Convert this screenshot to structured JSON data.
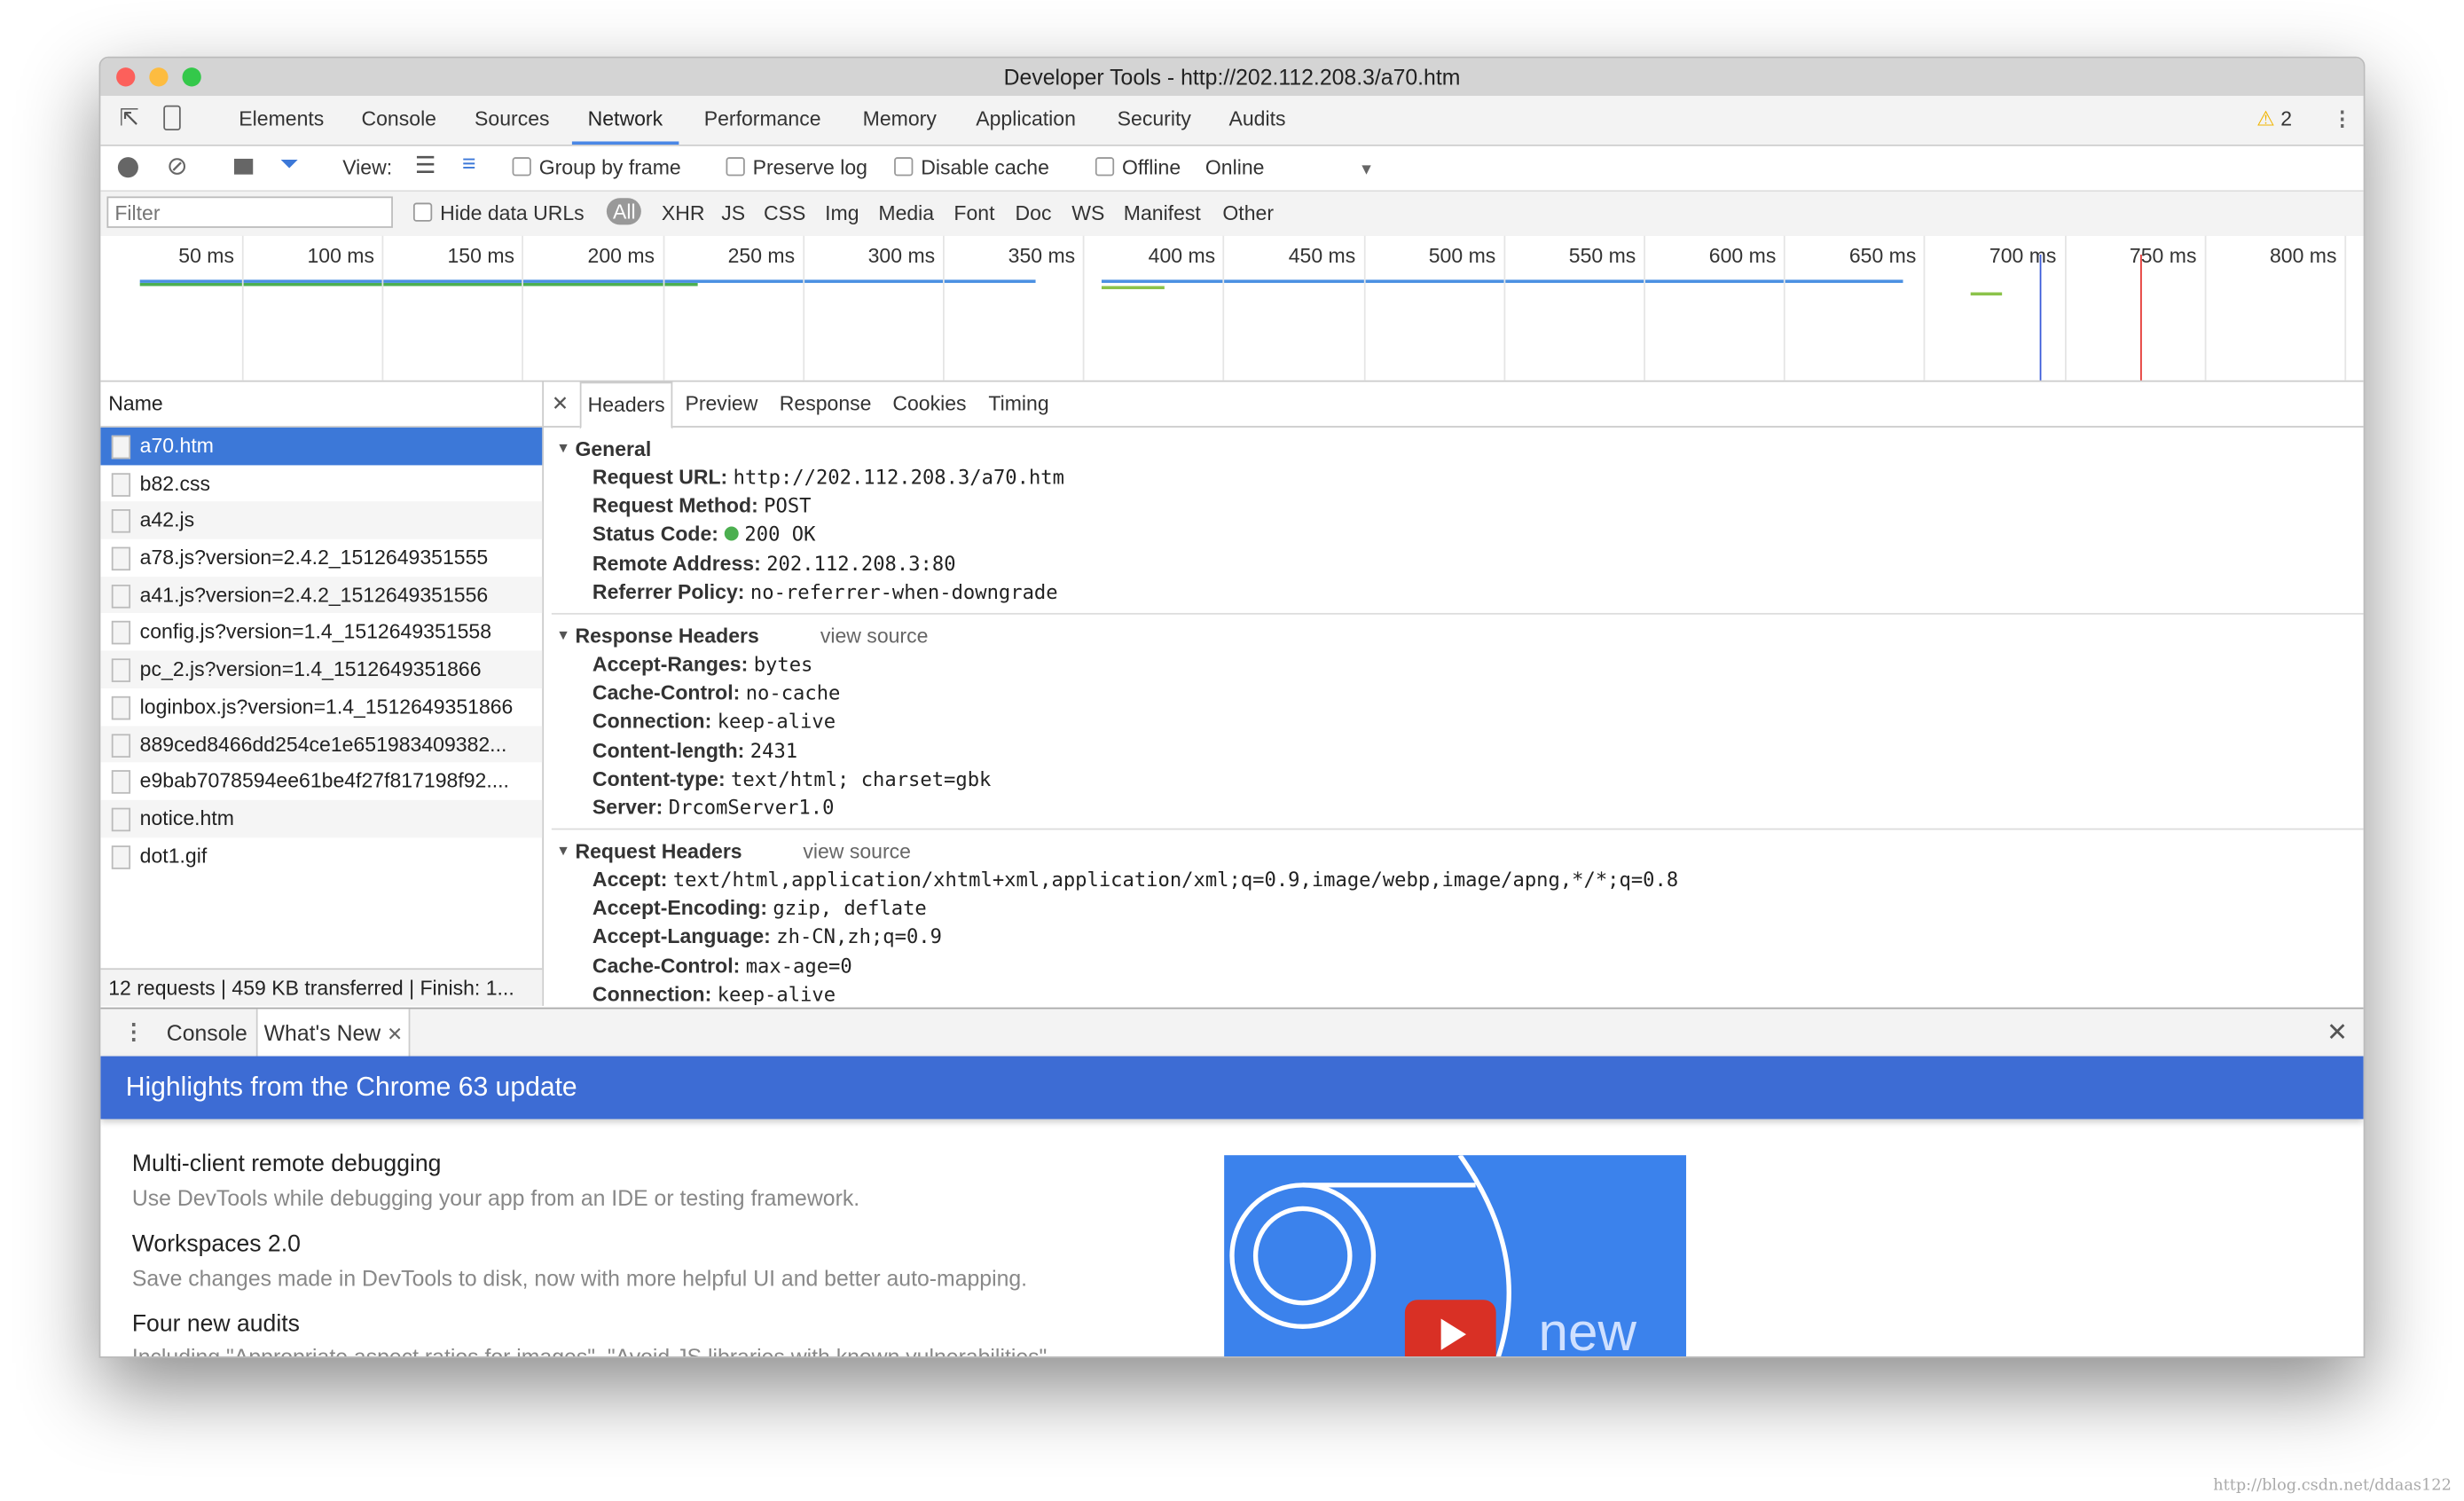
{
  "window": {
    "title": "Developer Tools - http://202.112.208.3/a70.htm"
  },
  "tabs": [
    "Elements",
    "Console",
    "Sources",
    "Network",
    "Performance",
    "Memory",
    "Application",
    "Security",
    "Audits"
  ],
  "active_tab": "Network",
  "warnings": {
    "count": "2"
  },
  "toolbar": {
    "view_label": "View:",
    "group_by_frame": "Group by frame",
    "preserve_log": "Preserve log",
    "disable_cache": "Disable cache",
    "offline": "Offline",
    "throttle": "Online"
  },
  "filterbar": {
    "placeholder": "Filter",
    "hide_data_urls": "Hide data URLs",
    "types": [
      "All",
      "XHR",
      "JS",
      "CSS",
      "Img",
      "Media",
      "Font",
      "Doc",
      "WS",
      "Manifest",
      "Other"
    ]
  },
  "timeline": {
    "ticks": [
      "50 ms",
      "100 ms",
      "150 ms",
      "200 ms",
      "250 ms",
      "300 ms",
      "350 ms",
      "400 ms",
      "450 ms",
      "500 ms",
      "550 ms",
      "600 ms",
      "650 ms",
      "700 ms",
      "750 ms",
      "800 ms"
    ]
  },
  "requests": {
    "header": "Name",
    "items": [
      "a70.htm",
      "b82.css",
      "a42.js",
      "a78.js?version=2.4.2_1512649351555",
      "a41.js?version=2.4.2_1512649351556",
      "config.js?version=1.4_1512649351558",
      "pc_2.js?version=1.4_1512649351866",
      "loginbox.js?version=1.4_1512649351866",
      "889ced8466dd254ce1e651983409382...",
      "e9bab7078594ee61be4f27f817198f92....",
      "notice.htm",
      "dot1.gif"
    ],
    "selected": "a70.htm",
    "status": "12 requests | 459 KB transferred | Finish: 1..."
  },
  "detail": {
    "tabs": [
      "Headers",
      "Preview",
      "Response",
      "Cookies",
      "Timing"
    ],
    "active": "Headers",
    "general": {
      "title": "General",
      "rows": [
        [
          "Request URL:",
          "http://202.112.208.3/a70.htm"
        ],
        [
          "Request Method:",
          "POST"
        ],
        [
          "Status Code:",
          "200 OK"
        ],
        [
          "Remote Address:",
          "202.112.208.3:80"
        ],
        [
          "Referrer Policy:",
          "no-referrer-when-downgrade"
        ]
      ]
    },
    "response": {
      "title": "Response Headers",
      "view_source": "view source",
      "rows": [
        [
          "Accept-Ranges:",
          "bytes"
        ],
        [
          "Cache-Control:",
          "no-cache"
        ],
        [
          "Connection:",
          "keep-alive"
        ],
        [
          "Content-length:",
          "2431"
        ],
        [
          "Content-type:",
          "text/html; charset=gbk"
        ],
        [
          "Server:",
          "DrcomServer1.0"
        ]
      ]
    },
    "request": {
      "title": "Request Headers",
      "view_source": "view source",
      "rows": [
        [
          "Accept:",
          "text/html,application/xhtml+xml,application/xml;q=0.9,image/webp,image/apng,*/*;q=0.8"
        ],
        [
          "Accept-Encoding:",
          "gzip, deflate"
        ],
        [
          "Accept-Language:",
          "zh-CN,zh;q=0.9"
        ],
        [
          "Cache-Control:",
          "max-age=0"
        ],
        [
          "Connection:",
          "keep-alive"
        ]
      ]
    }
  },
  "drawer": {
    "tabs": [
      "Console",
      "What's New"
    ],
    "banner": "Highlights from the Chrome 63 update",
    "items": [
      {
        "title": "Multi-client remote debugging",
        "desc": "Use DevTools while debugging your app from an IDE or testing framework."
      },
      {
        "title": "Workspaces 2.0",
        "desc": "Save changes made in DevTools to disk, now with more helpful UI and better auto-mapping."
      },
      {
        "title": "Four new audits",
        "desc": "Including \"Appropriate aspect ratios for images\", \"Avoid JS libraries with known vulnerabilities\""
      }
    ],
    "video_label": "new"
  },
  "watermark": "http://blog.csdn.net/ddaas122",
  "colors": {
    "accent": "#3c78d8",
    "banner": "#3d6cd4",
    "status_ok": "#4caf50"
  }
}
